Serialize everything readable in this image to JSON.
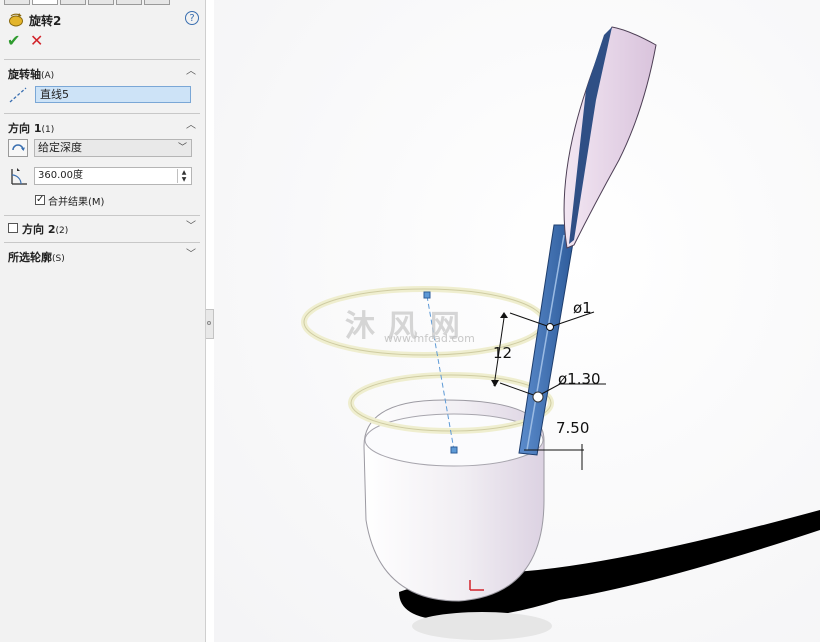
{
  "property_manager": {
    "feature_title": "旋转2",
    "help_glyph": "?",
    "ok_glyph": "✔",
    "cancel_glyph": "✕",
    "sections": {
      "axis": {
        "title": "旋转轴",
        "suffix": "(A)",
        "value": "直线5"
      },
      "direction1": {
        "title": "方向 1",
        "suffix": "(1)",
        "end_condition": "给定深度",
        "angle": "360.00度",
        "merge_label": "合并结果(M)",
        "merge_checked": true
      },
      "direction2": {
        "title": "方向 2",
        "suffix": "(2)",
        "checked": false
      },
      "contours": {
        "title": "所选轮廓",
        "suffix": "(S)"
      }
    },
    "icons": [
      "revolve-feature-icon",
      "help-icon",
      "ok-icon",
      "cancel-icon",
      "axis-line-icon",
      "reverse-direction-icon",
      "angle-icon"
    ]
  },
  "viewport": {
    "dimensions": {
      "d1": "ø1",
      "height": "12",
      "d2": "ø1.30",
      "width": "7.50"
    },
    "watermark": {
      "text": "沐 风 网",
      "url": "www.mfcad.com"
    },
    "colors": {
      "bowl": "#f4f1f6",
      "handle": "#3d6fae",
      "blade": "#e8d7ea",
      "sweep": "#efeecf"
    }
  }
}
